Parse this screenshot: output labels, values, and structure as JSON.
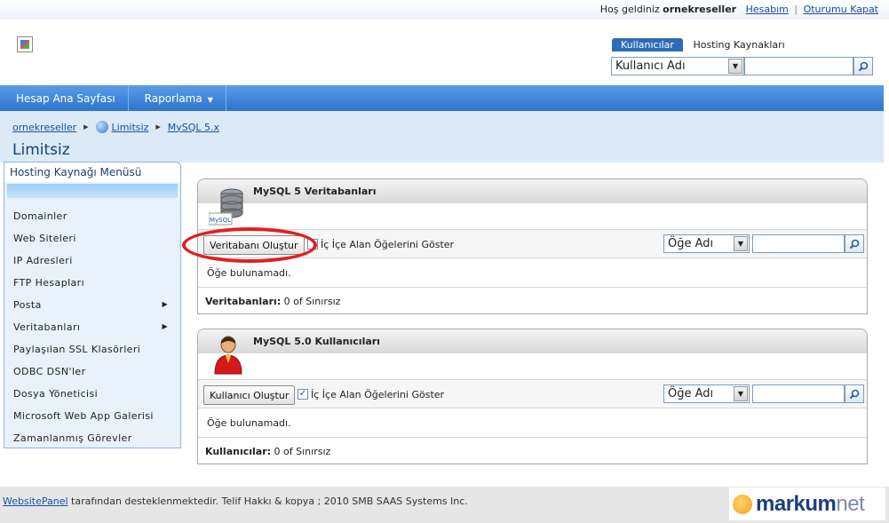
{
  "header": {
    "welcome_text": "Hoş geldiniz",
    "username": "ornekreseller",
    "account_link": "Hesabım",
    "separator": "|",
    "logout_link": "Oturumu Kapat"
  },
  "search": {
    "tabs": [
      "Kullanıcılar",
      "Hosting Kaynakları"
    ],
    "selected_field": "Kullanıcı Adı",
    "query": ""
  },
  "nav": {
    "items": [
      "Hesap Ana Sayfası",
      "Raporlama"
    ]
  },
  "breadcrumb": {
    "items": [
      "ornekreseller",
      "Limitsiz",
      "MySQL 5.x"
    ]
  },
  "page_title": "Limitsiz",
  "sidebar": {
    "title": "Hosting Kaynağı Menüsü",
    "items": [
      {
        "label": "Domainler"
      },
      {
        "label": "Web Siteleri"
      },
      {
        "label": "IP Adresleri"
      },
      {
        "label": "FTP Hesapları"
      },
      {
        "label": "Posta"
      },
      {
        "label": "Veritabanları"
      },
      {
        "label": "Paylaşılan SSL Klasörleri"
      },
      {
        "label": "ODBC DSN'ler"
      },
      {
        "label": "Dosya Yöneticisi"
      },
      {
        "label": "Microsoft Web App Galerisi"
      },
      {
        "label": "Zamanlanmış Görevler"
      }
    ]
  },
  "databases_panel": {
    "title": "MySQL 5 Veritabanları",
    "icon_label": "MySQL",
    "create_button": "Veritabanı Oluştur",
    "show_nested_label": "İç İçe Alan Öğelerini Göster",
    "show_nested_checked": false,
    "filter_field": "Öğe Adı",
    "filter_query": "",
    "empty_message": "Öğe bulunamadı.",
    "count_label": "Veritabanları:",
    "count_value": "0 of Sınırsız"
  },
  "users_panel": {
    "title": "MySQL 5.0 Kullanıcıları",
    "create_button": "Kullanıcı Oluştur",
    "show_nested_label": "İç İçe Alan Öğelerini Göster",
    "show_nested_checked": true,
    "filter_field": "Öğe Adı",
    "filter_query": "",
    "empty_message": "Öğe bulunamadı.",
    "count_label": "Kullanıcılar:",
    "count_value": "0 of Sınırsız"
  },
  "footer": {
    "link": "WebsitePanel",
    "text": " tarafından desteklenmektedir. Telif Hakkı & kopya ; 2010 SMB SAAS Systems Inc.",
    "brand_main": "markum",
    "brand_suffix": "net"
  },
  "colors": {
    "nav_bar": "#2e74cf",
    "crumb_bg": "#dbeaf6",
    "annotation": "#e02020",
    "link": "#1a4fa0"
  },
  "icons": [
    "logo-icon",
    "search-icon",
    "chevron-down-icon",
    "breadcrumb-arrow-icon",
    "globe-icon",
    "database-icon",
    "user-icon",
    "submenu-arrow-icon",
    "brand-logo-icon"
  ]
}
